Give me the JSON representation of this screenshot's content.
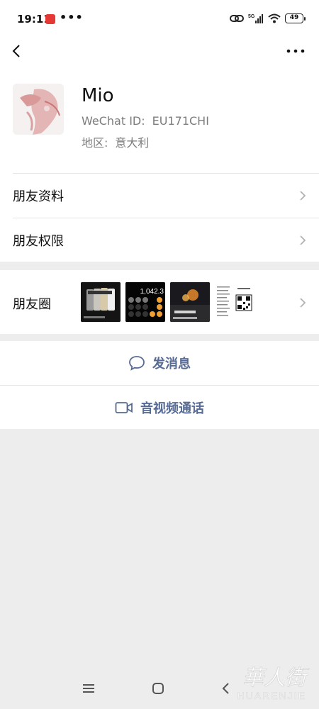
{
  "status_bar": {
    "time": "19:11",
    "dots": "•••",
    "network": "5G",
    "battery": "49"
  },
  "nav": {
    "back_icon": "chevron-left-icon",
    "more_icon": "more-dots-icon"
  },
  "profile": {
    "name": "Mio",
    "wechat_id_label": "WeChat ID:",
    "wechat_id_value": "EU171CHI",
    "region_label": "地区:",
    "region_value": "意大利"
  },
  "menu": {
    "friend_info": "朋友资料",
    "friend_permissions": "朋友权限",
    "moments": "朋友圈"
  },
  "moments_thumbs": [
    {
      "caption": "",
      "display": "888"
    },
    {
      "caption": "",
      "display": "1,042.3"
    },
    {
      "caption": "",
      "display": ""
    },
    {
      "caption": "",
      "display": ""
    }
  ],
  "actions": {
    "send_message": "发消息",
    "video_call": "音视频通话"
  },
  "watermark": {
    "chinese": "華人街",
    "english": "HUARENJIE"
  },
  "colors": {
    "link_blue": "#576b95",
    "background_gray": "#ededed"
  }
}
